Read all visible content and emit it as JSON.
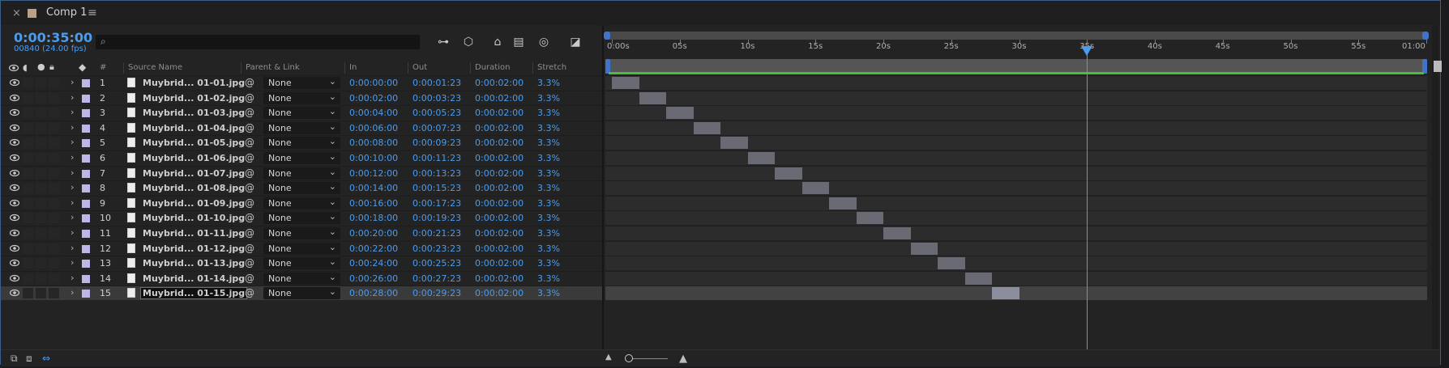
{
  "window": {
    "close": "×",
    "title": "Comp 1",
    "menu": "≡"
  },
  "timecode": "0:00:35:00",
  "frames": "00840 (24.00 fps)",
  "search": {
    "placeholder": "",
    "icon": "search-icon"
  },
  "columns": {
    "source_name": "Source Name",
    "number": "#",
    "parent_link": "Parent & Link",
    "in": "In",
    "out": "Out",
    "duration": "Duration",
    "stretch": "Stretch"
  },
  "ruler": {
    "labels": [
      "0:00s",
      "05s",
      "10s",
      "15s",
      "20s",
      "25s",
      "30s",
      "35s",
      "40s",
      "45s",
      "50s",
      "55s",
      "01:00"
    ],
    "current_time_seconds": 35
  },
  "layers": [
    {
      "num": "1",
      "name": "Muybrid... 01-01.jpg",
      "parent": "None",
      "in": "0:00:00:00",
      "out": "0:00:01:23",
      "duration": "0:00:02:00",
      "stretch": "3.3%"
    },
    {
      "num": "2",
      "name": "Muybrid... 01-02.jpg",
      "parent": "None",
      "in": "0:00:02:00",
      "out": "0:00:03:23",
      "duration": "0:00:02:00",
      "stretch": "3.3%"
    },
    {
      "num": "3",
      "name": "Muybrid... 01-03.jpg",
      "parent": "None",
      "in": "0:00:04:00",
      "out": "0:00:05:23",
      "duration": "0:00:02:00",
      "stretch": "3.3%"
    },
    {
      "num": "4",
      "name": "Muybrid... 01-04.jpg",
      "parent": "None",
      "in": "0:00:06:00",
      "out": "0:00:07:23",
      "duration": "0:00:02:00",
      "stretch": "3.3%"
    },
    {
      "num": "5",
      "name": "Muybrid... 01-05.jpg",
      "parent": "None",
      "in": "0:00:08:00",
      "out": "0:00:09:23",
      "duration": "0:00:02:00",
      "stretch": "3.3%"
    },
    {
      "num": "6",
      "name": "Muybrid... 01-06.jpg",
      "parent": "None",
      "in": "0:00:10:00",
      "out": "0:00:11:23",
      "duration": "0:00:02:00",
      "stretch": "3.3%"
    },
    {
      "num": "7",
      "name": "Muybrid... 01-07.jpg",
      "parent": "None",
      "in": "0:00:12:00",
      "out": "0:00:13:23",
      "duration": "0:00:02:00",
      "stretch": "3.3%"
    },
    {
      "num": "8",
      "name": "Muybrid... 01-08.jpg",
      "parent": "None",
      "in": "0:00:14:00",
      "out": "0:00:15:23",
      "duration": "0:00:02:00",
      "stretch": "3.3%"
    },
    {
      "num": "9",
      "name": "Muybrid... 01-09.jpg",
      "parent": "None",
      "in": "0:00:16:00",
      "out": "0:00:17:23",
      "duration": "0:00:02:00",
      "stretch": "3.3%"
    },
    {
      "num": "10",
      "name": "Muybrid... 01-10.jpg",
      "parent": "None",
      "in": "0:00:18:00",
      "out": "0:00:19:23",
      "duration": "0:00:02:00",
      "stretch": "3.3%"
    },
    {
      "num": "11",
      "name": "Muybrid... 01-11.jpg",
      "parent": "None",
      "in": "0:00:20:00",
      "out": "0:00:21:23",
      "duration": "0:00:02:00",
      "stretch": "3.3%"
    },
    {
      "num": "12",
      "name": "Muybrid... 01-12.jpg",
      "parent": "None",
      "in": "0:00:22:00",
      "out": "0:00:23:23",
      "duration": "0:00:02:00",
      "stretch": "3.3%"
    },
    {
      "num": "13",
      "name": "Muybrid... 01-13.jpg",
      "parent": "None",
      "in": "0:00:24:00",
      "out": "0:00:25:23",
      "duration": "0:00:02:00",
      "stretch": "3.3%"
    },
    {
      "num": "14",
      "name": "Muybrid... 01-14.jpg",
      "parent": "None",
      "in": "0:00:26:00",
      "out": "0:00:27:23",
      "duration": "0:00:02:00",
      "stretch": "3.3%"
    },
    {
      "num": "15",
      "name": "Muybrid... 01-15.jpg",
      "parent": "None",
      "in": "0:00:28:00",
      "out": "0:00:29:23",
      "duration": "0:00:02:00",
      "stretch": "3.3%",
      "selected": true
    }
  ],
  "colors": {
    "accent": "#4c9ced",
    "label": "#bdb6e6",
    "work_area_green": "#47bf3d"
  }
}
